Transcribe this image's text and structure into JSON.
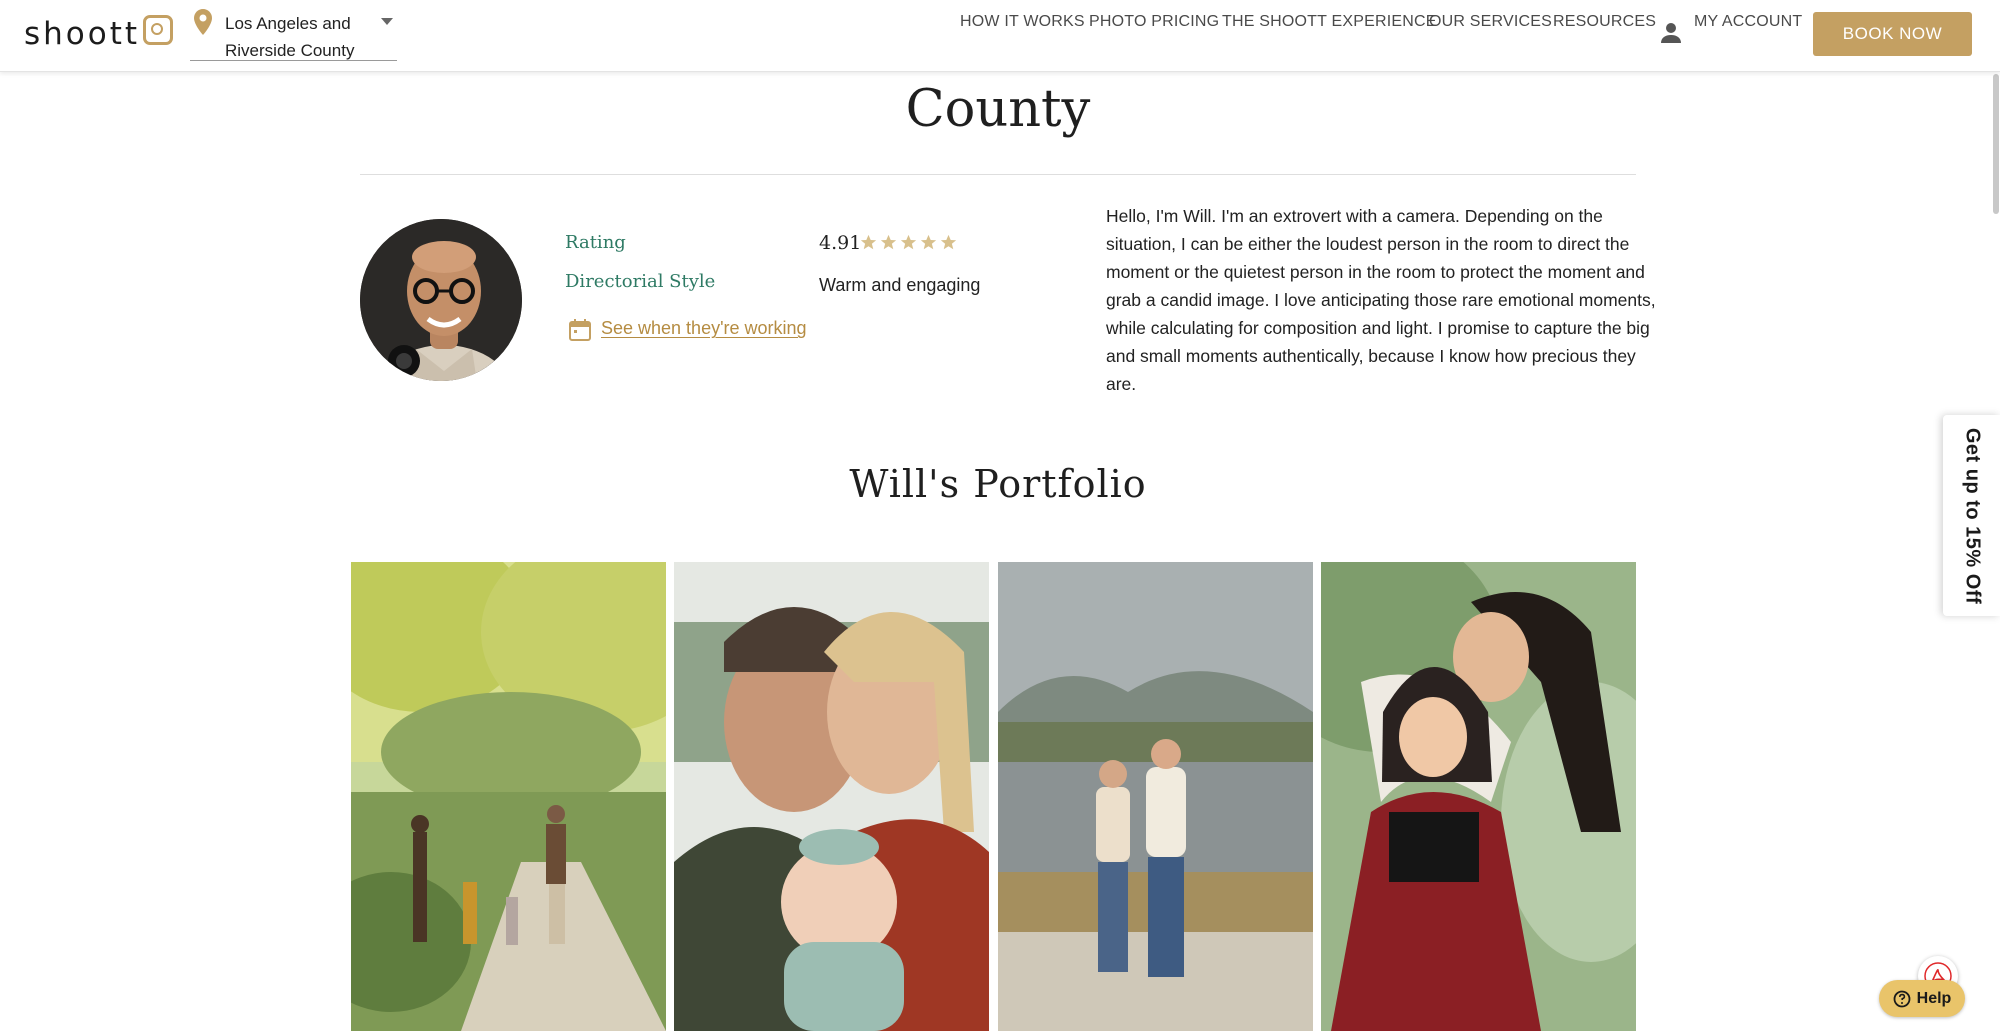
{
  "header": {
    "logo_text": "shoott",
    "location": "Los Angeles and Riverside County",
    "nav": [
      {
        "label": "HOW IT WORKS"
      },
      {
        "label": "PHOTO PRICING"
      },
      {
        "label": "THE SHOOTT EXPERIENCE"
      },
      {
        "label": "OUR SERVICES"
      },
      {
        "label": "RESOURCES"
      },
      {
        "label": "MY ACCOUNT"
      }
    ],
    "book_label": "BOOK NOW"
  },
  "page": {
    "title_line": "County"
  },
  "profile": {
    "rating_label": "Rating",
    "rating_value": "4.91",
    "stars": 5,
    "style_label": "Directorial Style",
    "style_value": "Warm and engaging",
    "schedule_link": "See when they're working",
    "bio": "Hello, I'm Will. I'm an extrovert with a camera. Depending on the situation, I can be either the loudest person in the room to direct the moment or the quietest person in the room to protect the moment and grab a candid image. I love anticipating those rare emotional moments, while calculating for composition and light. I promise to capture the big and small moments authentically, because I know how precious they are."
  },
  "portfolio": {
    "title": "Will's Portfolio"
  },
  "side_tab": {
    "label": "Get up to 15% Off"
  },
  "help": {
    "label": "Help"
  },
  "colors": {
    "brand_gold": "#c4a062",
    "label_green": "#2e7a64",
    "link_gold": "#b58c42",
    "help_yellow": "#e9c46a"
  }
}
